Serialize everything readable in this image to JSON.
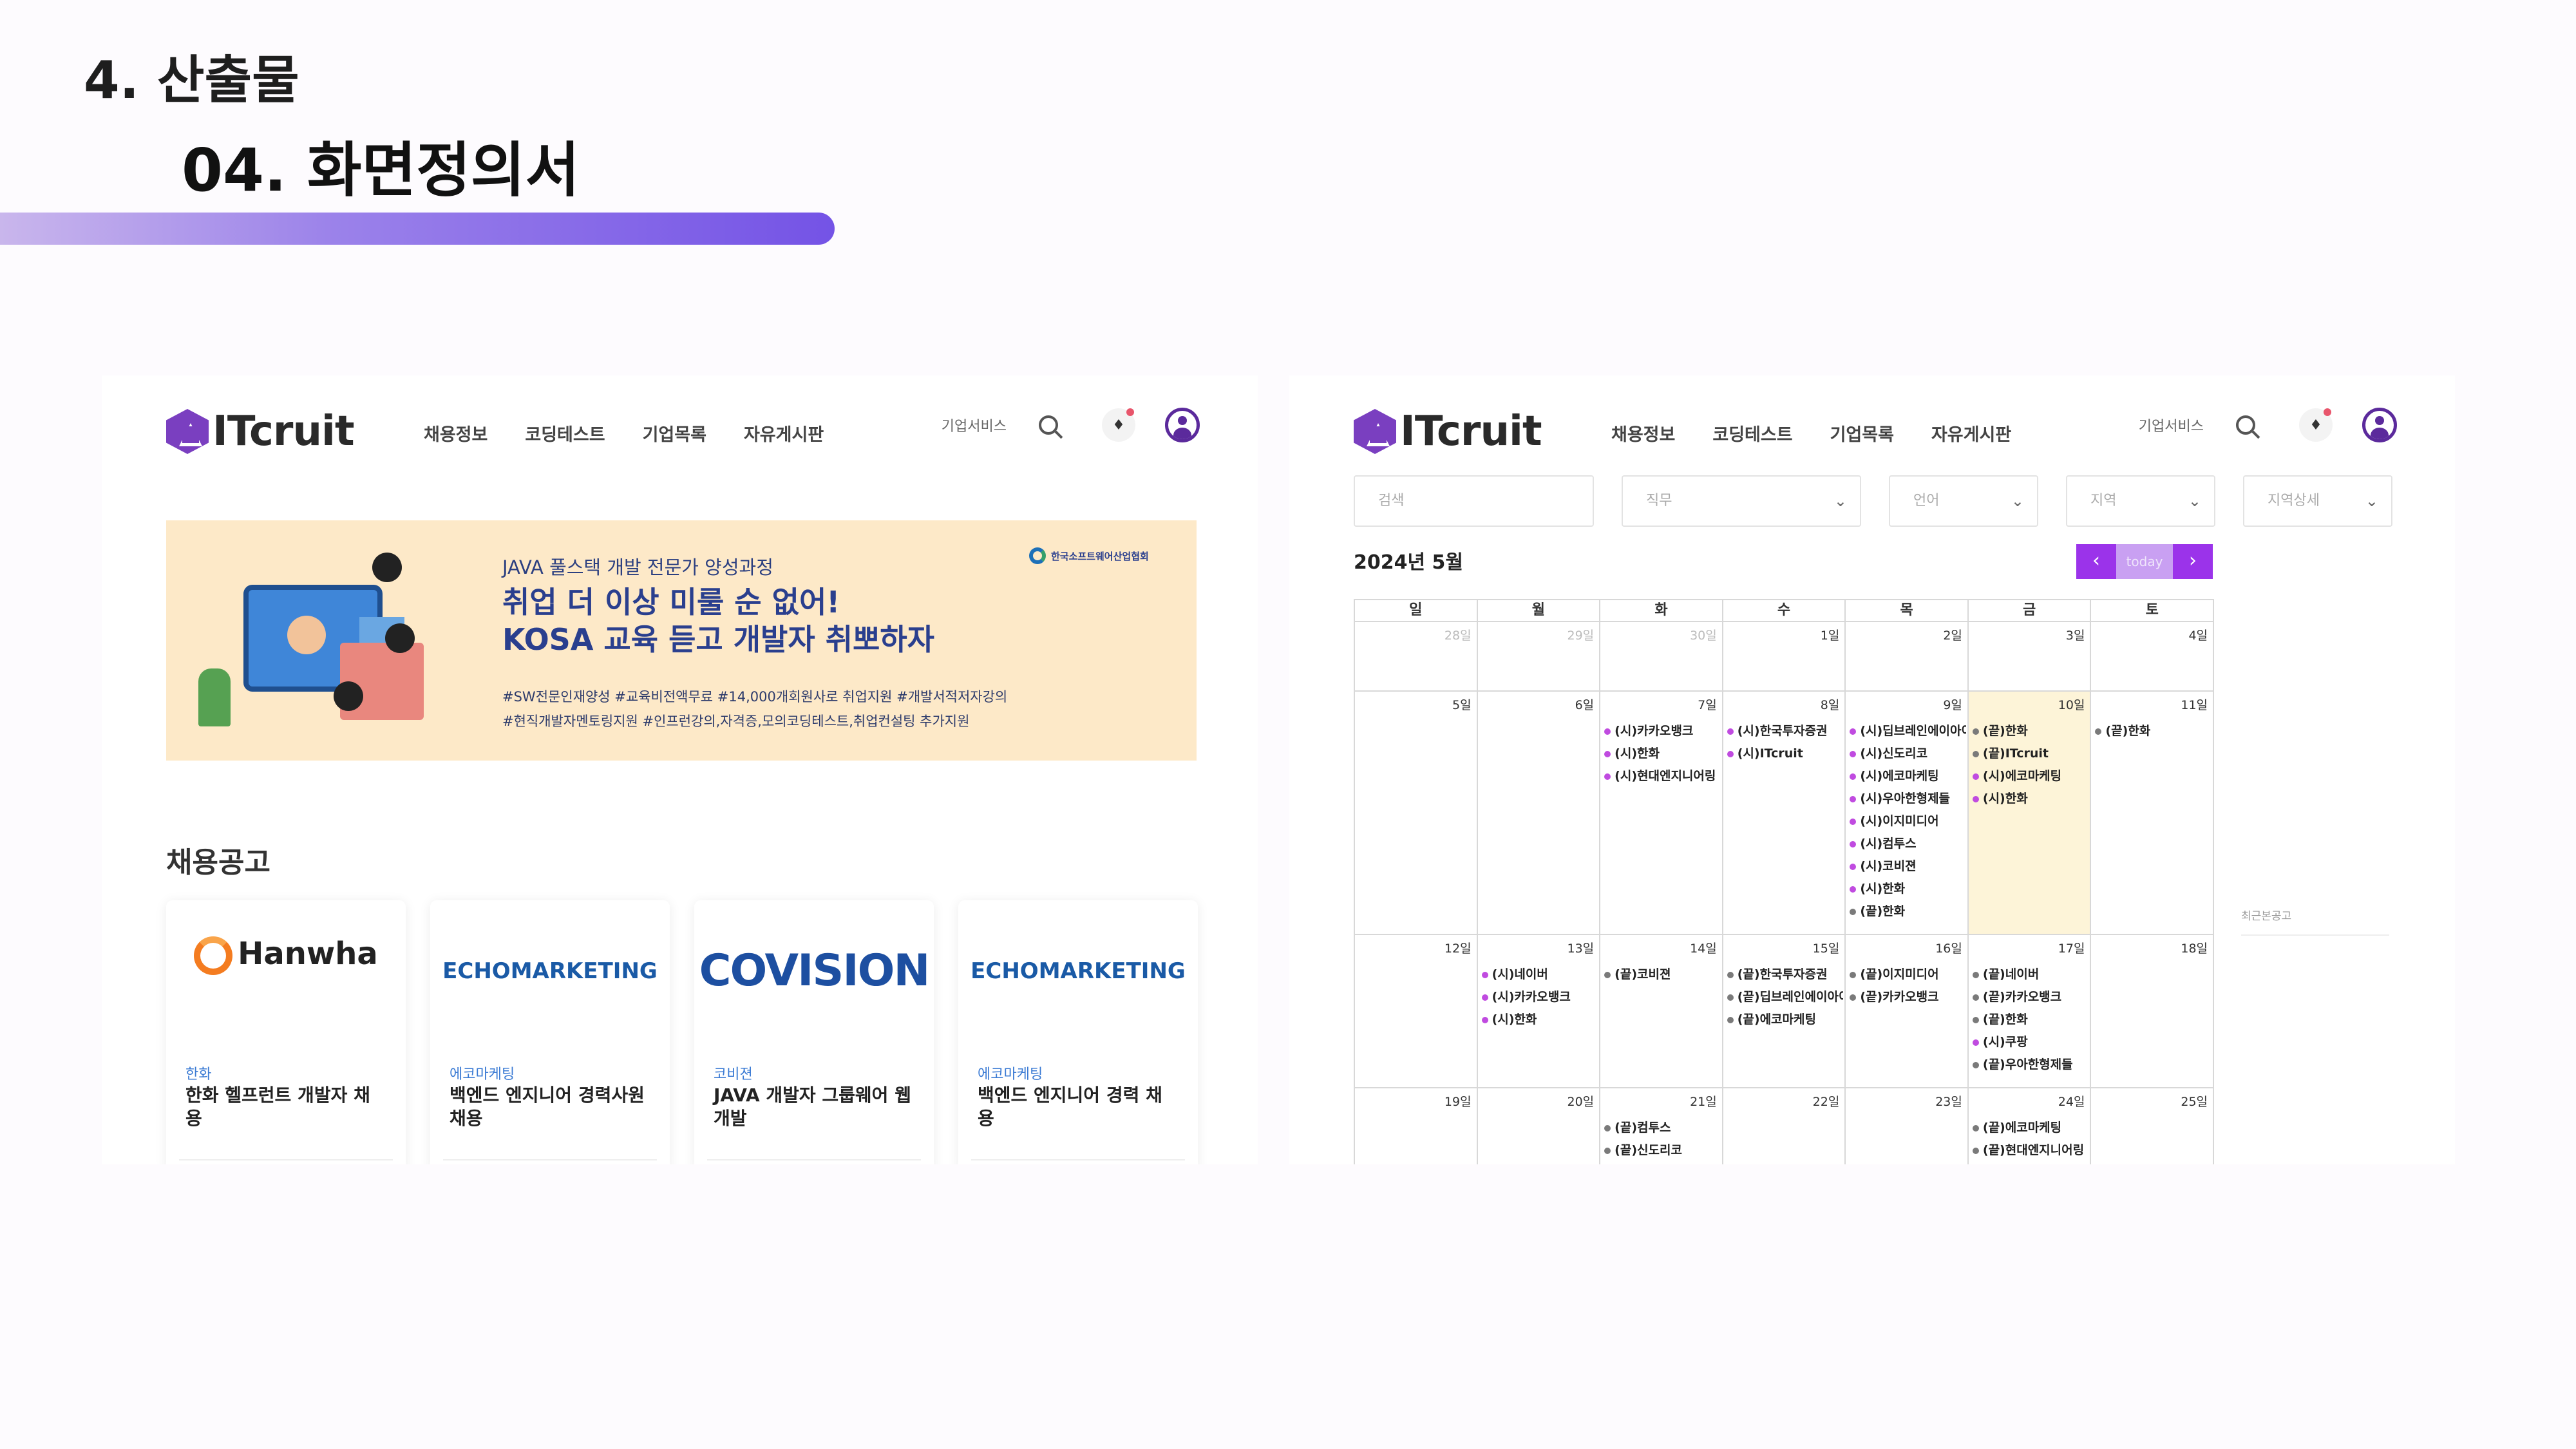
{
  "slide": {
    "number": "4.  산출물",
    "subtitle": "04. 화면정의서"
  },
  "header": {
    "logo": "ITcruit",
    "nav": [
      "채용정보",
      "코딩테스트",
      "기업목록",
      "자유게시판"
    ],
    "corp_service": "기업서비스",
    "icons": [
      "search-icon",
      "bell-icon",
      "user-icon"
    ]
  },
  "banner": {
    "kicker": "JAVA 풀스택 개발 전문가 양성과정",
    "title_line1": "취업 더 이상 미룰 순 없어!",
    "title_line2": "KOSA 교육 듣고 개발자 취뽀하자",
    "tags_line1": "#SW전문인재양성 #교육비전액무료 #14,000개회원사로 취업지원 #개발서적저자강의",
    "tags_line2": "#현직개발자멘토링지원 #인프런강의,자격증,모의코딩테스트,취업컨설팅 추가지원",
    "org": "한국소프트웨어산업협회"
  },
  "jobs": {
    "section_title": "채용공고",
    "items": [
      {
        "logo": "Hanwha",
        "company": "한화",
        "title": "한화 헬프런트 개발자 채용"
      },
      {
        "logo": "ECHOMARKETING",
        "company": "에코마케팅",
        "title": "백엔드 엔지니어 경력사원 채용"
      },
      {
        "logo": "COVISION",
        "company": "코비젼",
        "title": "JAVA 개발자 그룹웨어 웹 개발"
      },
      {
        "logo": "ECHOMARKETING",
        "company": "에코마케팅",
        "title": "백엔드 엔지니어 경력 채용"
      }
    ]
  },
  "filters": [
    {
      "label": "검색",
      "dropdown": false
    },
    {
      "label": "직무",
      "dropdown": true
    },
    {
      "label": "언어",
      "dropdown": true
    },
    {
      "label": "지역",
      "dropdown": true
    },
    {
      "label": "지역상세",
      "dropdown": true
    }
  ],
  "calendar": {
    "month": "2024년 5월",
    "today_label": "today",
    "prev": "‹",
    "next": "›",
    "weekdays": [
      "일",
      "월",
      "화",
      "수",
      "목",
      "금",
      "토"
    ],
    "colors": {
      "start": "#c04be0",
      "end": "#7a7a7a",
      "highlight": "#fdf4d8"
    },
    "weeks": [
      [
        {
          "d": "28일",
          "dim": true,
          "e": []
        },
        {
          "d": "29일",
          "dim": true,
          "e": []
        },
        {
          "d": "30일",
          "dim": true,
          "e": []
        },
        {
          "d": "1일",
          "e": []
        },
        {
          "d": "2일",
          "e": []
        },
        {
          "d": "3일",
          "e": []
        },
        {
          "d": "4일",
          "e": []
        }
      ],
      [
        {
          "d": "5일",
          "e": []
        },
        {
          "d": "6일",
          "e": []
        },
        {
          "d": "7일",
          "e": [
            [
              "s",
              "(시)카카오뱅크"
            ],
            [
              "s",
              "(시)한화"
            ],
            [
              "s",
              "(시)현대엔지니어링"
            ]
          ]
        },
        {
          "d": "8일",
          "e": [
            [
              "s",
              "(시)한국투자증권"
            ],
            [
              "s",
              "(시)ITcruit"
            ]
          ]
        },
        {
          "d": "9일",
          "e": [
            [
              "s",
              "(시)딥브레인에이아이"
            ],
            [
              "s",
              "(시)신도리코"
            ],
            [
              "s",
              "(시)에코마케팅"
            ],
            [
              "s",
              "(시)우아한형제들"
            ],
            [
              "s",
              "(시)이지미디어"
            ],
            [
              "s",
              "(시)컴투스"
            ],
            [
              "s",
              "(시)코비젼"
            ],
            [
              "s",
              "(시)한화"
            ],
            [
              "g",
              "(끝)한화"
            ]
          ]
        },
        {
          "d": "10일",
          "hl": true,
          "e": [
            [
              "g",
              "(끝)한화"
            ],
            [
              "g",
              "(끝)ITcruit"
            ],
            [
              "s",
              "(시)에코마케팅"
            ],
            [
              "s",
              "(시)한화"
            ]
          ]
        },
        {
          "d": "11일",
          "e": [
            [
              "g",
              "(끝)한화"
            ]
          ]
        }
      ],
      [
        {
          "d": "12일",
          "e": []
        },
        {
          "d": "13일",
          "e": [
            [
              "s",
              "(시)네이버"
            ],
            [
              "s",
              "(시)카카오뱅크"
            ],
            [
              "s",
              "(시)한화"
            ]
          ]
        },
        {
          "d": "14일",
          "e": [
            [
              "g",
              "(끝)코비젼"
            ]
          ]
        },
        {
          "d": "15일",
          "e": [
            [
              "g",
              "(끝)한국투자증권"
            ],
            [
              "g",
              "(끝)딥브레인에이아이"
            ],
            [
              "g",
              "(끝)에코마케팅"
            ]
          ]
        },
        {
          "d": "16일",
          "e": [
            [
              "g",
              "(끝)이지미디어"
            ],
            [
              "g",
              "(끝)카카오뱅크"
            ]
          ]
        },
        {
          "d": "17일",
          "e": [
            [
              "g",
              "(끝)네이버"
            ],
            [
              "g",
              "(끝)카카오뱅크"
            ],
            [
              "g",
              "(끝)한화"
            ],
            [
              "s",
              "(시)쿠팡"
            ],
            [
              "g",
              "(끝)우아한형제들"
            ]
          ]
        },
        {
          "d": "18일",
          "e": []
        }
      ],
      [
        {
          "d": "19일",
          "e": []
        },
        {
          "d": "20일",
          "e": []
        },
        {
          "d": "21일",
          "e": [
            [
              "g",
              "(끝)컴투스"
            ],
            [
              "g",
              "(끝)신도리코"
            ]
          ]
        },
        {
          "d": "22일",
          "e": []
        },
        {
          "d": "23일",
          "e": []
        },
        {
          "d": "24일",
          "e": [
            [
              "g",
              "(끝)에코마케팅"
            ],
            [
              "g",
              "(끝)현대엔지니어링"
            ]
          ]
        },
        {
          "d": "25일",
          "e": []
        }
      ]
    ],
    "recent_label": "최근본공고"
  }
}
